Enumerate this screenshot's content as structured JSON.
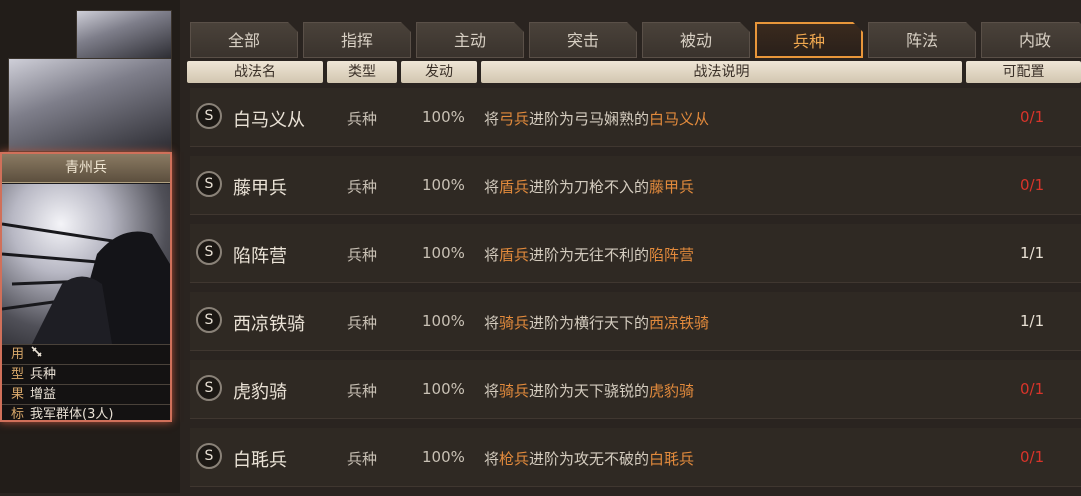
{
  "card": {
    "title": "青州兵",
    "info": [
      {
        "key": "用",
        "value": "",
        "icon": "sword-icon"
      },
      {
        "key": "型",
        "value": "兵种"
      },
      {
        "key": "果",
        "value": "增益"
      },
      {
        "key": "标",
        "value": "我军群体(3人)"
      }
    ]
  },
  "tabs": [
    "全部",
    "指挥",
    "主动",
    "突击",
    "被动",
    "兵种",
    "阵法",
    "内政"
  ],
  "active_tab": "兵种",
  "headers": {
    "name": "战法名",
    "type": "类型",
    "rate": "发动",
    "desc": "战法说明",
    "cfg": "可配置"
  },
  "rows": [
    {
      "badge": "S",
      "name": "白马义从",
      "type": "兵种",
      "rate": "100%",
      "d1": "将",
      "d2": "弓兵",
      "d3": "进阶为弓马娴熟的",
      "d4": "白马义从",
      "cfg": "0/1",
      "cfg_color": "#d8342a"
    },
    {
      "badge": "S",
      "name": "藤甲兵",
      "type": "兵种",
      "rate": "100%",
      "d1": "将",
      "d2": "盾兵",
      "d3": "进阶为刀枪不入的",
      "d4": "藤甲兵",
      "cfg": "0/1",
      "cfg_color": "#d8342a"
    },
    {
      "badge": "S",
      "name": "陷阵营",
      "type": "兵种",
      "rate": "100%",
      "d1": "将",
      "d2": "盾兵",
      "d3": "进阶为无往不利的",
      "d4": "陷阵营",
      "cfg": "1/1",
      "cfg_color": "#e8e0d4"
    },
    {
      "badge": "S",
      "name": "西凉铁骑",
      "type": "兵种",
      "rate": "100%",
      "d1": "将",
      "d2": "骑兵",
      "d3": "进阶为横行天下的",
      "d4": "西凉铁骑",
      "cfg": "1/1",
      "cfg_color": "#e8e0d4"
    },
    {
      "badge": "S",
      "name": "虎豹骑",
      "type": "兵种",
      "rate": "100%",
      "d1": "将",
      "d2": "骑兵",
      "d3": "进阶为天下骁锐的",
      "d4": "虎豹骑",
      "cfg": "0/1",
      "cfg_color": "#d8342a"
    },
    {
      "badge": "S",
      "name": "白毦兵",
      "type": "兵种",
      "rate": "100%",
      "d1": "将",
      "d2": "枪兵",
      "d3": "进阶为攻无不破的",
      "d4": "白毦兵",
      "cfg": "0/1",
      "cfg_color": "#d8342a"
    }
  ]
}
